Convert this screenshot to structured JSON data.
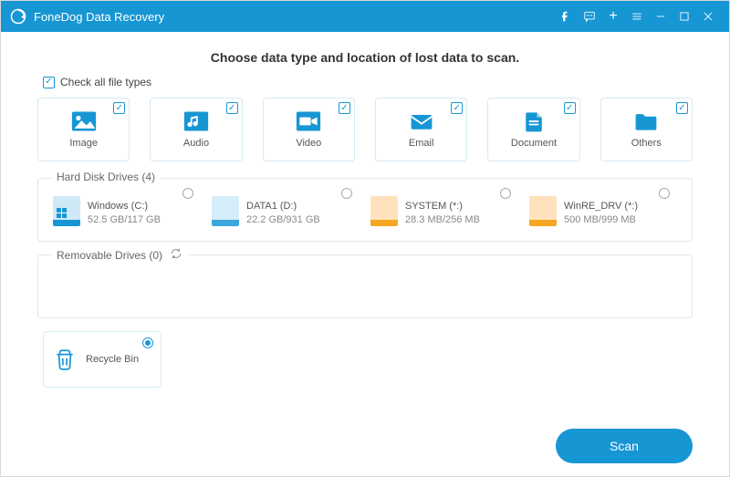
{
  "titlebar": {
    "title": "FoneDog Data Recovery"
  },
  "headline": "Choose data type and location of lost data to scan.",
  "checkall_label": "Check all file types",
  "filetypes": [
    {
      "key": "image",
      "label": "Image"
    },
    {
      "key": "audio",
      "label": "Audio"
    },
    {
      "key": "video",
      "label": "Video"
    },
    {
      "key": "email",
      "label": "Email"
    },
    {
      "key": "document",
      "label": "Document"
    },
    {
      "key": "others",
      "label": "Others"
    }
  ],
  "hdd": {
    "title": "Hard Disk Drives (4)",
    "drives": [
      {
        "name": "Windows (C:)",
        "size": "52.5 GB/117 GB",
        "theme": "blue",
        "win": true
      },
      {
        "name": "DATA1 (D:)",
        "size": "22.2 GB/931 GB",
        "theme": "bluel",
        "win": false
      },
      {
        "name": "SYSTEM (*:)",
        "size": "28.3 MB/256 MB",
        "theme": "org",
        "win": false
      },
      {
        "name": "WinRE_DRV (*:)",
        "size": "500 MB/999 MB",
        "theme": "org2",
        "win": false
      }
    ]
  },
  "removable": {
    "title": "Removable Drives (0)"
  },
  "recycle": {
    "label": "Recycle Bin"
  },
  "scan_label": "Scan"
}
